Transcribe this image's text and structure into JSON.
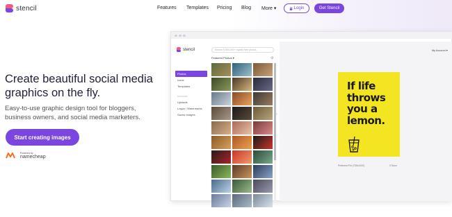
{
  "brand": {
    "name": "stencil",
    "colors": {
      "primary": "#7b45e0",
      "logo_pink": "#f25a7e"
    }
  },
  "nav": {
    "items": [
      "Features",
      "Templates",
      "Pricing",
      "Blog"
    ],
    "more_label": "More",
    "login_label": "Login",
    "cta_label": "Get Stencil"
  },
  "hero": {
    "title": "Create beautiful social media graphics on the fly.",
    "subtitle": "Easy-to-use graphic design tool for bloggers, business owners, and social media marketers.",
    "cta_label": "Start creating images",
    "powered_by": "Powered by",
    "powered_name": "namecheap"
  },
  "app": {
    "logo_text": "stencil",
    "search_placeholder": "Search 5,000,000+ royalty free photos",
    "featured_label": "Featured Photos",
    "account_label": "My Account",
    "sidebar": {
      "items": [
        "Photos",
        "Icons",
        "Templates"
      ],
      "section_label": "ACCOUNT",
      "account_items": [
        "Uploads",
        "Logos / Watermarks",
        "Saved Images"
      ]
    },
    "poster": {
      "text": "If life throws you a lemon.",
      "background": "#f3e521"
    },
    "meta_left": "Pinterest Pin (735x1102)",
    "meta_right": "0 Save"
  }
}
